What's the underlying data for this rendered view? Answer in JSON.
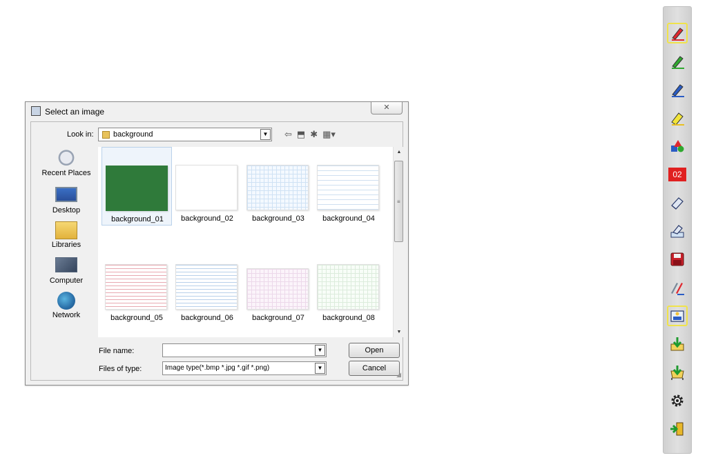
{
  "dialog": {
    "title": "Select an image",
    "close_glyph": "✕",
    "look_in_label": "Look in:",
    "look_in_value": "background",
    "places": [
      {
        "label": "Recent Places",
        "icon": "recent-places-icon"
      },
      {
        "label": "Desktop",
        "icon": "desktop-icon"
      },
      {
        "label": "Libraries",
        "icon": "libraries-icon"
      },
      {
        "label": "Computer",
        "icon": "computer-icon"
      },
      {
        "label": "Network",
        "icon": "network-icon"
      }
    ],
    "files": [
      {
        "name": "background_01",
        "pattern": "green"
      },
      {
        "name": "background_02",
        "pattern": "blank"
      },
      {
        "name": "background_03",
        "pattern": "grid"
      },
      {
        "name": "background_04",
        "pattern": "lines"
      },
      {
        "name": "background_05",
        "pattern": "red-lines"
      },
      {
        "name": "background_06",
        "pattern": "blue-lines"
      },
      {
        "name": "background_07",
        "pattern": "pink-grid"
      },
      {
        "name": "background_08",
        "pattern": "green-grid"
      }
    ],
    "selected_file": "background_01",
    "file_name_label": "File name:",
    "file_name_value": "",
    "files_of_type_label": "Files of type:",
    "files_of_type_value": "Image type(*.bmp *.jpg *.gif *.png)",
    "open_label": "Open",
    "cancel_label": "Cancel"
  },
  "toolbar": {
    "page_number": "02",
    "tools": [
      {
        "name": "red-pen",
        "color": "#e0282f",
        "active": true
      },
      {
        "name": "green-pen",
        "color": "#2fa82f",
        "active": false
      },
      {
        "name": "blue-pen",
        "color": "#2a5cc4",
        "active": false
      },
      {
        "name": "highlighter",
        "color": "#f2e53a",
        "active": false
      },
      {
        "name": "shapes",
        "active": false
      },
      {
        "name": "page-number",
        "active": false
      },
      {
        "name": "eraser",
        "active": false
      },
      {
        "name": "clear-screen",
        "active": false
      },
      {
        "name": "save",
        "active": false
      },
      {
        "name": "pen-settings",
        "active": false
      },
      {
        "name": "background",
        "active": true
      },
      {
        "name": "import",
        "active": false
      },
      {
        "name": "export",
        "active": false
      },
      {
        "name": "settings",
        "active": false
      },
      {
        "name": "exit",
        "active": false
      }
    ]
  }
}
